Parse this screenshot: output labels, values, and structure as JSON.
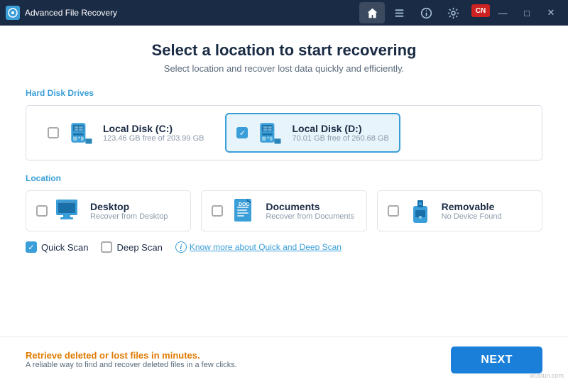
{
  "app": {
    "title": "Advanced File Recovery",
    "logo": "R"
  },
  "titlebar": {
    "nav": [
      {
        "icon": "🏠",
        "label": "home",
        "active": true
      },
      {
        "icon": "≡",
        "label": "list",
        "active": false
      },
      {
        "icon": "ℹ",
        "label": "info",
        "active": false
      },
      {
        "icon": "⚙",
        "label": "settings",
        "active": false
      }
    ],
    "controls": [
      {
        "icon": "🏴",
        "label": "flag"
      },
      {
        "icon": "—",
        "label": "minimize"
      },
      {
        "icon": "□",
        "label": "maximize"
      },
      {
        "icon": "✕",
        "label": "close"
      }
    ]
  },
  "header": {
    "title": "Select a location to start recovering",
    "subtitle": "Select location and recover lost data quickly and efficiently."
  },
  "drives_section": {
    "label": "Hard Disk Drives",
    "drives": [
      {
        "name": "Local Disk (C:)",
        "space": "123.46 GB free of 203.99 GB",
        "selected": false
      },
      {
        "name": "Local Disk (D:)",
        "space": "70.01 GB free of 260.68 GB",
        "selected": true
      }
    ]
  },
  "location_section": {
    "label": "Location",
    "locations": [
      {
        "name": "Desktop",
        "desc": "Recover from Desktop",
        "selected": false
      },
      {
        "name": "Documents",
        "desc": "Recover from Documents",
        "selected": false
      },
      {
        "name": "Removable",
        "desc": "No Device Found",
        "selected": false
      }
    ]
  },
  "scan_options": {
    "quick_scan": {
      "label": "Quick Scan",
      "checked": true
    },
    "deep_scan": {
      "label": "Deep Scan",
      "checked": false
    },
    "link_text": "Know more about Quick and Deep Scan"
  },
  "footer": {
    "promo": "Retrieve deleted or lost files in minutes.",
    "sub": "A reliable way to find and recover deleted files in a few clicks.",
    "next_button": "NEXT"
  },
  "watermark": "wustun.com"
}
